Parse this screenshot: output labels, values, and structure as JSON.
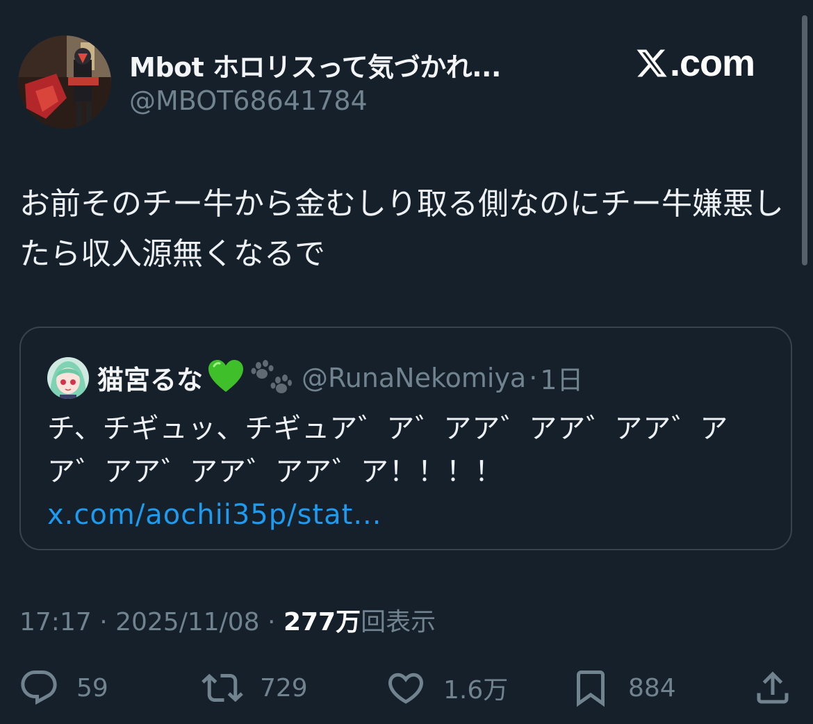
{
  "author": {
    "display_name": "Mbot ホロリスって気づかれ...",
    "handle": "@MBOT68641784"
  },
  "brand": {
    "domain_text": ".com"
  },
  "tweet": {
    "text": "お前そのチー牛から金むしり取る側なのにチー牛嫌悪したら収入源無くなるで"
  },
  "quote": {
    "display_name": "猫宮るな",
    "emojis": [
      "green-heart",
      "paw-prints"
    ],
    "handle": "@RunaNekomiya",
    "separator": "·",
    "time": "1日",
    "text": "チ、チギュッ、チギュア゛ア゛アア゛アア゛アア゛アア゛アア゛アア゛アア゛ア！！！！ ",
    "link": "x.com/aochii35p/stat..."
  },
  "meta": {
    "time": "17:17",
    "dot": " · ",
    "date": "2025/11/08",
    "views_count": "277万",
    "views_label": "回表示"
  },
  "actions": {
    "reply_count": "59",
    "retweet_count": "729",
    "like_count": "1.6万",
    "bookmark_count": "884"
  },
  "colors": {
    "background": "#15202b",
    "link": "#1d9bf0",
    "muted": "#71838f",
    "border": "#38444d"
  }
}
